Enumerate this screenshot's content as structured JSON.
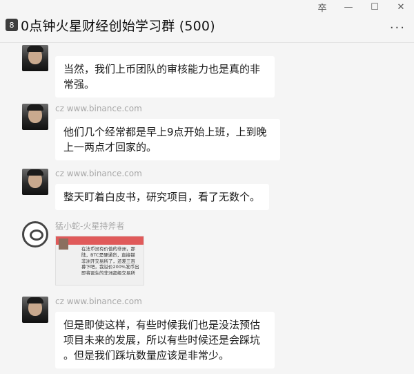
{
  "window": {
    "title": "0点钟火星财经创始学习群 (500)",
    "badge": "8",
    "controls": {
      "pin": "卒",
      "minimize": "—",
      "maximize": "☐",
      "close": "✕"
    },
    "more": "···"
  },
  "messages": [
    {
      "sender": "cz www.binance.com",
      "text": [
        "当然，我们上币团队的审核能力也是真的非",
        "常强。"
      ]
    },
    {
      "sender": "cz www.binance.com",
      "text": [
        "他们几个经常都是早上9点开始上班，上到晚",
        "上一两点才回家的。"
      ]
    },
    {
      "sender": "cz www.binance.com",
      "text": [
        "整天盯着白皮书，研究项目，看了无数个。"
      ]
    },
    {
      "sender": "猛小蛇-火星持斧者",
      "image_lines": [
        "在法币没有价值的非洲，那",
        "陆，BTC是硬通货，直接锚",
        "非洲开交易所了，还差三百",
        "募下吧，我溢价200%发币出",
        "即将诞生的非洲超级交易所"
      ]
    },
    {
      "sender": "cz www.binance.com",
      "text": [
        "但是即使这样，有些时候我们也是没法预估",
        "项目未来的发展，所以有些时候还是会踩坑",
        "。但是我们踩坑数量应该是非常少。"
      ]
    }
  ]
}
